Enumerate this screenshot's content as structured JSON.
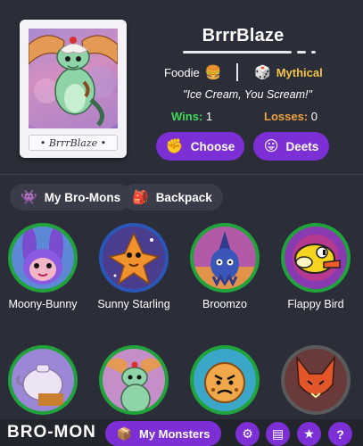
{
  "profile": {
    "name": "BrrrBlaze",
    "portrait_caption": "• BrrrBlaze •",
    "trait": {
      "label": "Foodie",
      "icon": "burger-icon",
      "glyph": "🍔"
    },
    "rarity": {
      "label": "Mythical",
      "icon": "dice-icon",
      "glyph": "🎲"
    },
    "quote": "\"Ice Cream, You Scream!\"",
    "wins_label": "Wins:",
    "wins_value": "1",
    "losses_label": "Losses:",
    "losses_value": "0",
    "choose_label": "Choose",
    "choose_glyph": "✊",
    "deets_label": "Deets",
    "deets_glyph": "😛"
  },
  "tabs": [
    {
      "label": "My Bro-Mons",
      "icon": "alien-monster-icon",
      "glyph": "👾"
    },
    {
      "label": "Backpack",
      "icon": "backpack-icon",
      "glyph": "🎒"
    }
  ],
  "monsters": [
    {
      "name": "Moony-Bunny",
      "ring": "#1fa33a"
    },
    {
      "name": "Sunny Starling",
      "ring": "#2a56b8"
    },
    {
      "name": "Broomzo",
      "ring": "#1fa33a"
    },
    {
      "name": "Flappy Bird",
      "ring": "#1fa33a"
    },
    {
      "name": "",
      "ring": "#1fa33a"
    },
    {
      "name": "",
      "ring": "#1fa33a"
    },
    {
      "name": "",
      "ring": "#1fa33a"
    },
    {
      "name": "",
      "ring": "#5a5a5a"
    }
  ],
  "bottom": {
    "brand": "BRO-MON",
    "my_monsters_label": "My Monsters",
    "my_monsters_glyph": "📦",
    "settings_glyph": "⚙",
    "chat_glyph": "▤",
    "star_glyph": "★",
    "help_glyph": "?"
  },
  "colors": {
    "background": "#2b2e38",
    "accent_purple": "#7b2fd4",
    "wins_green": "#3fd65a",
    "losses_orange": "#f0a13c",
    "rarity_gold": "#f2c34a"
  }
}
